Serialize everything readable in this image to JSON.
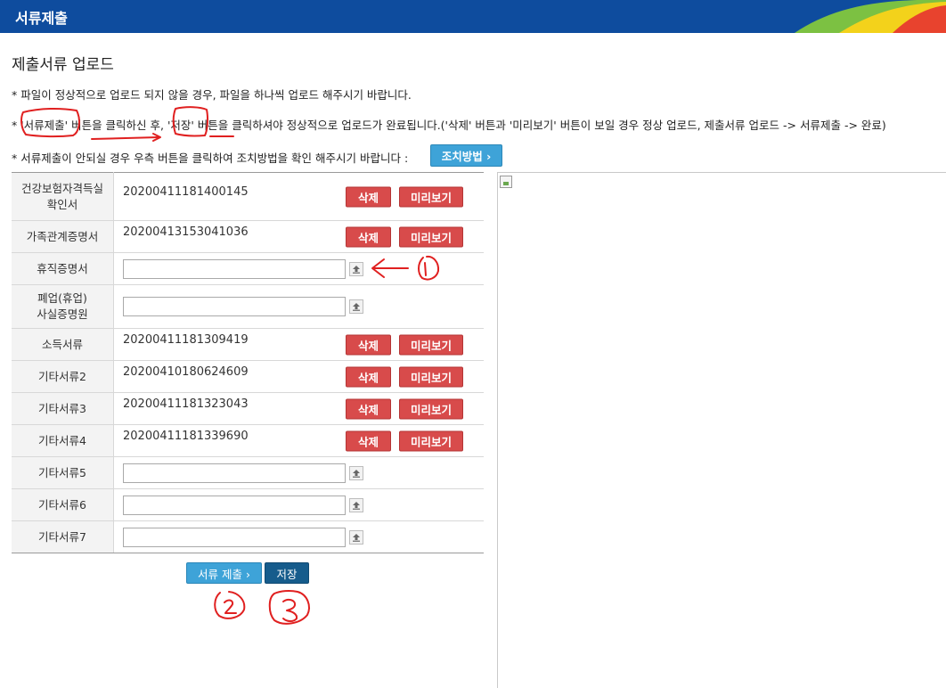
{
  "header": {
    "title": "서류제출"
  },
  "page": {
    "title": "제출서류 업로드"
  },
  "notices": [
    "* 파일이 정상적으로 업로드 되지 않을 경우, 파일을 하나씩 업로드 해주시기 바랍니다.",
    "* '서류제출' 버튼을 클릭하신 후, '저장' 버튼을 클릭하셔야 정상적으로 업로드가 완료됩니다.('삭제' 버튼과 '미리보기' 버튼이 보일 경우 정상 업로드, 제출서류 업로드 -> 서류제출 -> 완료)",
    "* 서류제출이 안되실 경우 우측 버튼을 클릭하여 조치방법을 확인 해주시기 바랍니다 :"
  ],
  "fix_button": {
    "label": "조치방법 ›"
  },
  "documents": [
    {
      "label": "건강보험자격득실\n확인서",
      "file": "20200411181400145",
      "delete_label": "삭제",
      "preview_label": "미리보기"
    },
    {
      "label": "가족관계증명서",
      "file": "20200413153041036",
      "delete_label": "삭제",
      "preview_label": "미리보기"
    },
    {
      "label": "휴직증명서",
      "file": ""
    },
    {
      "label": "폐업(휴업)\n사실증명원",
      "file": ""
    },
    {
      "label": "소득서류",
      "file": "20200411181309419",
      "delete_label": "삭제",
      "preview_label": "미리보기"
    },
    {
      "label": "기타서류2",
      "file": "20200410180624609",
      "delete_label": "삭제",
      "preview_label": "미리보기"
    },
    {
      "label": "기타서류3",
      "file": "20200411181323043",
      "delete_label": "삭제",
      "preview_label": "미리보기"
    },
    {
      "label": "기타서류4",
      "file": "20200411181339690",
      "delete_label": "삭제",
      "preview_label": "미리보기"
    },
    {
      "label": "기타서류5",
      "file": ""
    },
    {
      "label": "기타서류6",
      "file": ""
    },
    {
      "label": "기타서류7",
      "file": ""
    }
  ],
  "actions": {
    "submit_label": "서류 제출 ›",
    "save_label": "저장"
  },
  "colors": {
    "header_bg": "#0e4c9e",
    "primary_btn": "#3ea3d8",
    "danger_btn": "#d84b4b",
    "save_btn": "#165c8c",
    "annotation": "#e02020"
  },
  "icons": {
    "upload": "upload-icon",
    "broken_image": "broken-image-icon"
  }
}
